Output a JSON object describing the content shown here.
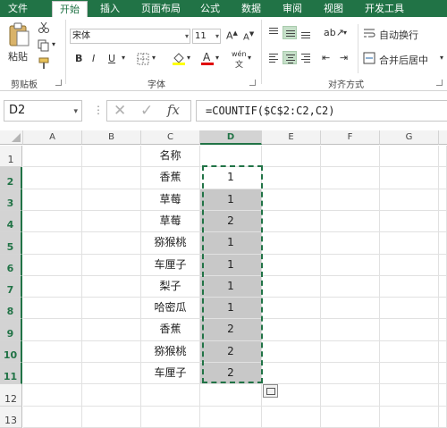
{
  "tabs": [
    {
      "label": "文件",
      "active": false
    },
    {
      "label": "开始",
      "active": true
    },
    {
      "label": "插入",
      "active": false
    },
    {
      "label": "页面布局",
      "active": false
    },
    {
      "label": "公式",
      "active": false
    },
    {
      "label": "数据",
      "active": false
    },
    {
      "label": "审阅",
      "active": false
    },
    {
      "label": "视图",
      "active": false
    },
    {
      "label": "开发工具",
      "active": false
    }
  ],
  "ribbon": {
    "clipboard": {
      "paste_label": "粘贴",
      "group_label": "剪贴板"
    },
    "font": {
      "name": "宋体",
      "size": "11",
      "group_label": "字体",
      "bold": "B",
      "italic": "I",
      "underline": "U",
      "font_color_letter": "A",
      "phonetic": "wén"
    },
    "alignment": {
      "wrap_text": "自动换行",
      "merge_center": "合并后居中",
      "group_label": "对齐方式"
    }
  },
  "formula_bar": {
    "name_box": "D2",
    "cancel": "✕",
    "enter": "✓",
    "fx": "fx",
    "formula": "=COUNTIF($C$2:C2,C2)"
  },
  "columns": [
    "A",
    "B",
    "C",
    "D",
    "E",
    "F",
    "G"
  ],
  "rows": [
    {
      "n": "1",
      "c": "名称",
      "d": ""
    },
    {
      "n": "2",
      "c": "香蕉",
      "d": "1"
    },
    {
      "n": "3",
      "c": "草莓",
      "d": "1"
    },
    {
      "n": "4",
      "c": "草莓",
      "d": "2"
    },
    {
      "n": "5",
      "c": "猕猴桃",
      "d": "1"
    },
    {
      "n": "6",
      "c": "车厘子",
      "d": "1"
    },
    {
      "n": "7",
      "c": "梨子",
      "d": "1"
    },
    {
      "n": "8",
      "c": "哈密瓜",
      "d": "1"
    },
    {
      "n": "9",
      "c": "香蕉",
      "d": "2"
    },
    {
      "n": "10",
      "c": "猕猴桃",
      "d": "2"
    },
    {
      "n": "11",
      "c": "车厘子",
      "d": "2"
    },
    {
      "n": "12",
      "c": "",
      "d": ""
    },
    {
      "n": "13",
      "c": "",
      "d": ""
    }
  ],
  "colors": {
    "accent": "#217346",
    "selection_fill": "#c8c8c8"
  }
}
